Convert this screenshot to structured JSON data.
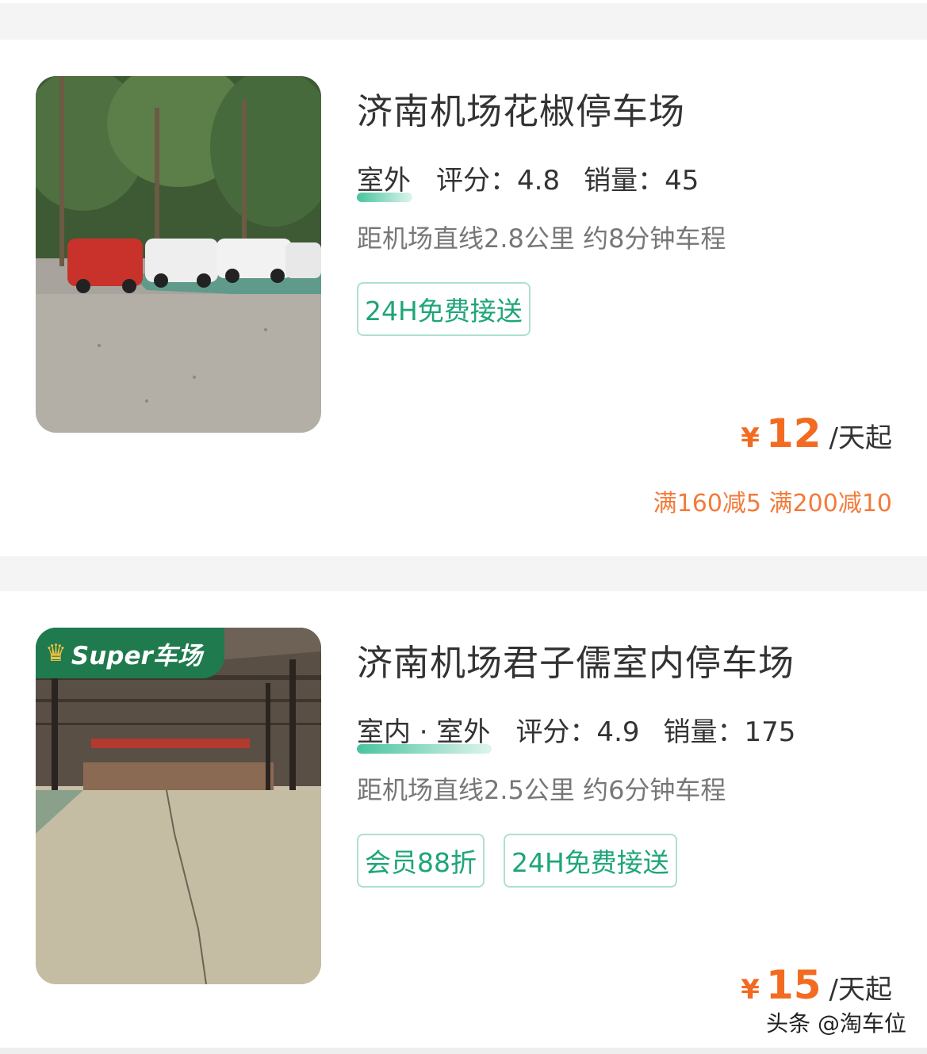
{
  "listings": [
    {
      "title": "济南机场花椒停车场",
      "kind": "室外",
      "rating": "评分：4.8",
      "sales": "销量：45",
      "distance": "距机场直线2.8公里 约8分钟车程",
      "tags": [
        "24H免费接送"
      ],
      "price": {
        "symbol": "¥",
        "amount": "12",
        "unit": "/天起"
      },
      "discount": "满160减5 满200减10"
    },
    {
      "badge": "Super车场",
      "title": "济南机场君子儒室内停车场",
      "kind": "室内 · 室外",
      "rating": "评分：4.9",
      "sales": "销量：175",
      "distance": "距机场直线2.5公里 约6分钟车程",
      "tags": [
        "会员88折",
        "24H免费接送"
      ],
      "price": {
        "symbol": "¥",
        "amount": "15",
        "unit": "/天起"
      }
    }
  ],
  "watermark": "头条 @淘车位",
  "colors": {
    "accent": "#f36b21",
    "tag_green": "#1ea57a",
    "badge_green": "#1f7a4e"
  }
}
